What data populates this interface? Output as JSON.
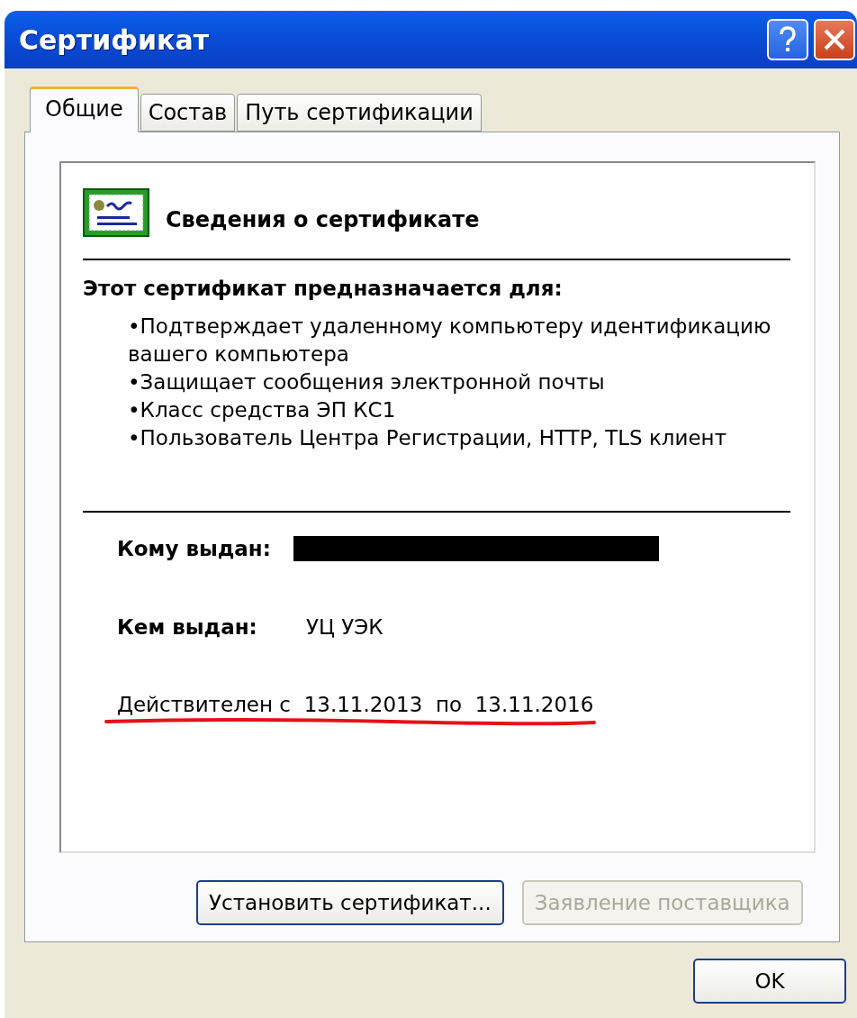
{
  "window": {
    "title": "Сертификат"
  },
  "tabs": [
    {
      "label": "Общие",
      "selected": true
    },
    {
      "label": "Состав",
      "selected": false
    },
    {
      "label": "Путь сертификации",
      "selected": false
    }
  ],
  "header": "Сведения о сертификате",
  "purpose_title": "Этот сертификат предназначается для:",
  "purposes": [
    "•Подтверждает удаленному компьютеру идентификацию вашего компьютера",
    "•Защищает сообщения электронной почты",
    "•Класс средства ЭП КС1",
    "•Пользователь Центра Регистрации, HTTP, TLS клиент"
  ],
  "issued_to": {
    "label": "Кому выдан:",
    "redacted": true
  },
  "issued_by": {
    "label": "Кем выдан:",
    "value": "УЦ УЭК"
  },
  "validity": {
    "label": "Действителен с",
    "from": "13.11.2013",
    "to_label": "по",
    "to": "13.11.2016",
    "underlined": true
  },
  "buttons": [
    {
      "label": "Установить сертификат...",
      "disabled": false
    },
    {
      "label": "Заявление поставщика",
      "disabled": true
    }
  ],
  "ok": "OK"
}
